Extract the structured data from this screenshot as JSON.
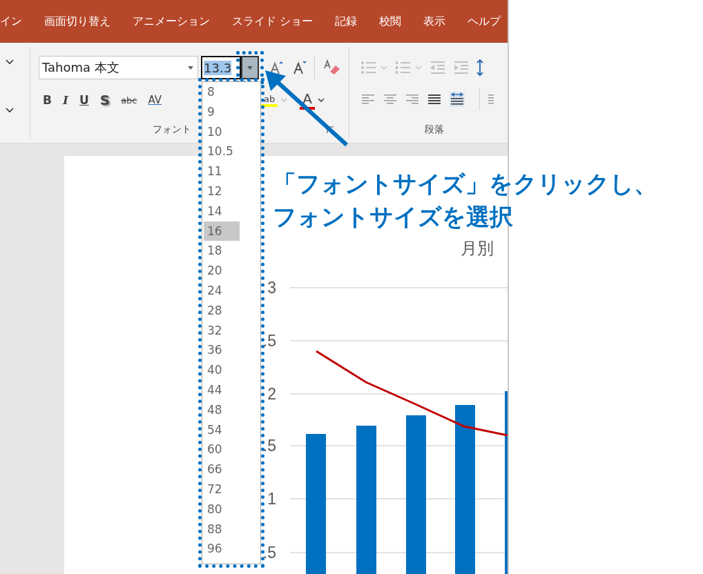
{
  "ribbon_tabs": [
    {
      "label": "イン",
      "selected": false
    },
    {
      "label": "画面切り替え",
      "selected": false
    },
    {
      "label": "アニメーション",
      "selected": false
    },
    {
      "label": "スライド ショー",
      "selected": false
    },
    {
      "label": "記録",
      "selected": false
    },
    {
      "label": "校閲",
      "selected": false
    },
    {
      "label": "表示",
      "selected": false
    },
    {
      "label": "ヘルプ",
      "selected": false
    }
  ],
  "font_group": {
    "font_name": "Tahoma 本文",
    "font_size": "13.3",
    "label": "フォント",
    "format_buttons": [
      {
        "kind": "bold",
        "label": "B"
      },
      {
        "kind": "italic",
        "label": "I"
      },
      {
        "kind": "underline",
        "label": "U"
      },
      {
        "kind": "shadow",
        "label": "S"
      },
      {
        "kind": "strike",
        "label": "abc"
      },
      {
        "kind": "spacing",
        "label": "AV"
      }
    ],
    "highlight_button": {
      "label": "ab"
    },
    "font_color_button": {
      "label": "A"
    }
  },
  "paragraph_group": {
    "label": "段落"
  },
  "font_size_list": [
    {
      "label": "8",
      "selected": false
    },
    {
      "label": "9",
      "selected": false
    },
    {
      "label": "10",
      "selected": false
    },
    {
      "label": "10.5",
      "selected": false
    },
    {
      "label": "11",
      "selected": false
    },
    {
      "label": "12",
      "selected": false
    },
    {
      "label": "14",
      "selected": false
    },
    {
      "label": "16",
      "selected": true
    },
    {
      "label": "18",
      "selected": false
    },
    {
      "label": "20",
      "selected": false
    },
    {
      "label": "24",
      "selected": false
    },
    {
      "label": "28",
      "selected": false
    },
    {
      "label": "32",
      "selected": false
    },
    {
      "label": "36",
      "selected": false
    },
    {
      "label": "40",
      "selected": false
    },
    {
      "label": "44",
      "selected": false
    },
    {
      "label": "48",
      "selected": false
    },
    {
      "label": "54",
      "selected": false
    },
    {
      "label": "60",
      "selected": false
    },
    {
      "label": "66",
      "selected": false
    },
    {
      "label": "72",
      "selected": false
    },
    {
      "label": "80",
      "selected": false
    },
    {
      "label": "88",
      "selected": false
    },
    {
      "label": "96",
      "selected": false
    }
  ],
  "callout": {
    "lines": [
      "「フォントサイズ」をクリックし、",
      "フォントサイズを選択"
    ]
  },
  "slide": {
    "chart_title": "月別",
    "y_axis_labels": [
      "3",
      ".5",
      "2",
      ".5",
      "1",
      ".5"
    ]
  }
}
